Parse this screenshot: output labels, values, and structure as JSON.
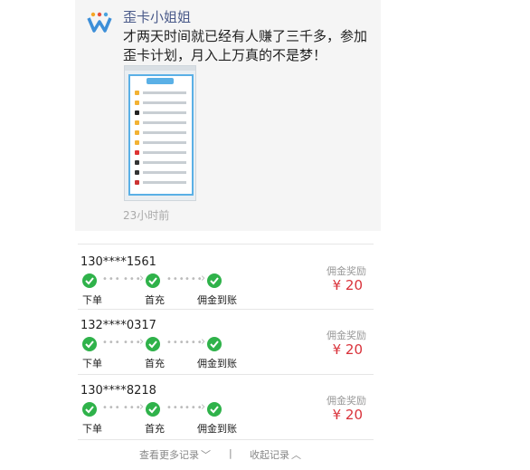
{
  "post": {
    "author": "歪卡小姐姐",
    "text_line1": "才两天时间就已经有人赚了三千多，参加",
    "text_line2": "歪卡计划，月入上万真的不是梦！",
    "timestamp": "23小时前"
  },
  "records": [
    {
      "phone": "130****1561",
      "steps": [
        "下单",
        "首充",
        "佣金到账"
      ],
      "reward_label": "佣金奖励",
      "reward_amount": "¥ 20"
    },
    {
      "phone": "132****0317",
      "steps": [
        "下单",
        "首充",
        "佣金到账"
      ],
      "reward_label": "佣金奖励",
      "reward_amount": "¥ 20"
    },
    {
      "phone": "130****8218",
      "steps": [
        "下单",
        "首充",
        "佣金到账"
      ],
      "reward_label": "佣金奖励",
      "reward_amount": "¥ 20"
    }
  ],
  "footer": {
    "more": "查看更多记录",
    "divider": "|",
    "collapse": "收起记录"
  },
  "colors": {
    "accent_green": "#2fb24a",
    "reward_red": "#d9323a",
    "author_blue": "#4a5a8a"
  }
}
